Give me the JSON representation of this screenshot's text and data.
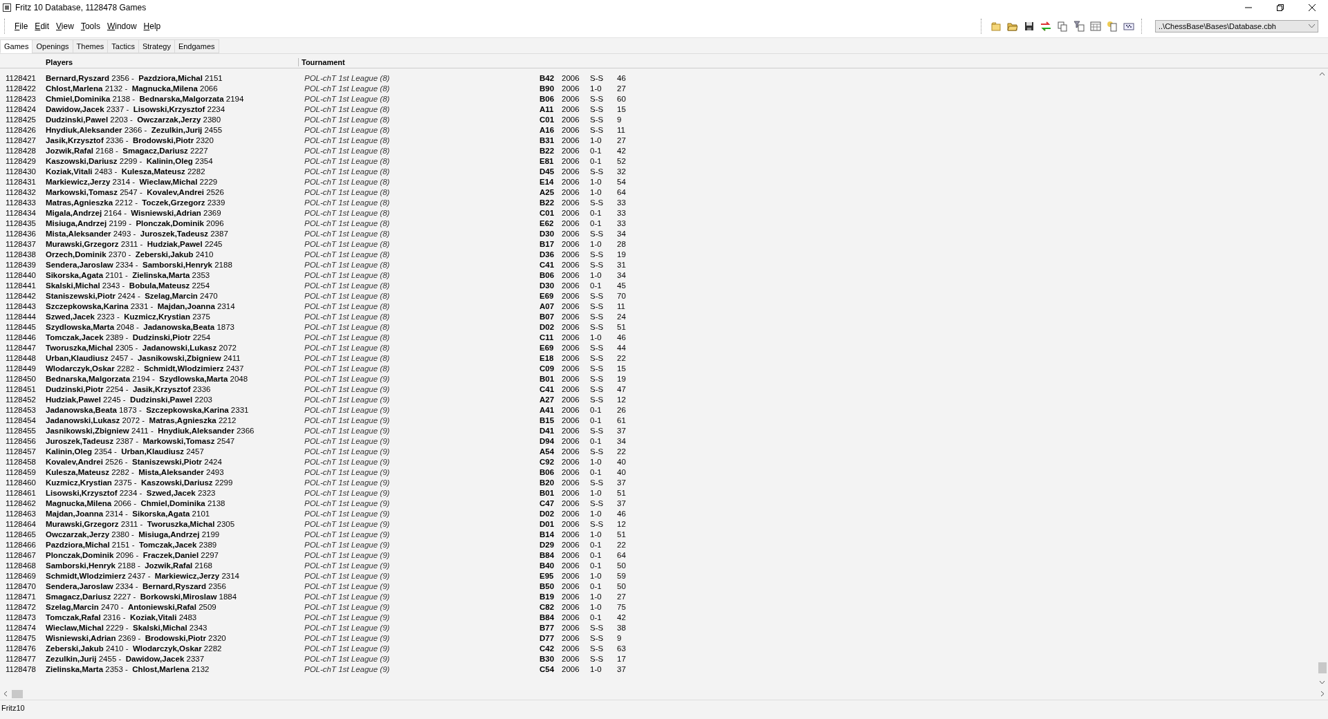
{
  "window": {
    "title": "Fritz 10 Database,  1128478 Games"
  },
  "menu": [
    "File",
    "Edit",
    "View",
    "Tools",
    "Window",
    "Help"
  ],
  "database_selector": {
    "value": "..\\ChessBase\\Bases\\Database.cbh"
  },
  "tabs": [
    {
      "label": "Games",
      "selected": true
    },
    {
      "label": "Openings",
      "selected": false
    },
    {
      "label": "Themes",
      "selected": false
    },
    {
      "label": "Tactics",
      "selected": false
    },
    {
      "label": "Strategy",
      "selected": false
    },
    {
      "label": "Endgames",
      "selected": false
    }
  ],
  "table": {
    "columns": [
      "Players",
      "Tournament"
    ],
    "rows": [
      {
        "no": "1128421",
        "players": "**Bernard,Ryszard** 2356 -  **Pazdziora,Michal** 2151",
        "tournament": "POL-chT 1st League (8)",
        "eco": "B42",
        "year": "2006",
        "result": "S-S",
        "moves": "46"
      },
      {
        "no": "1128422",
        "players": "**Chlost,Marlena** 2132 -  **Magnucka,Milena** 2066",
        "tournament": "POL-chT 1st League (8)",
        "eco": "B90",
        "year": "2006",
        "result": "1-0",
        "moves": "27"
      },
      {
        "no": "1128423",
        "players": "**Chmiel,Dominika** 2138 -  **Bednarska,Malgorzata** 2194",
        "tournament": "POL-chT 1st League (8)",
        "eco": "B06",
        "year": "2006",
        "result": "S-S",
        "moves": "60"
      },
      {
        "no": "1128424",
        "players": "**Dawidow,Jacek** 2337 -  **Lisowski,Krzysztof** 2234",
        "tournament": "POL-chT 1st League (8)",
        "eco": "A11",
        "year": "2006",
        "result": "S-S",
        "moves": "15"
      },
      {
        "no": "1128425",
        "players": "**Dudzinski,Pawel** 2203 -  **Owczarzak,Jerzy** 2380",
        "tournament": "POL-chT 1st League (8)",
        "eco": "C01",
        "year": "2006",
        "result": "S-S",
        "moves": "9"
      },
      {
        "no": "1128426",
        "players": "**Hnydiuk,Aleksander** 2366 -  **Zezulkin,Jurij** 2455",
        "tournament": "POL-chT 1st League (8)",
        "eco": "A16",
        "year": "2006",
        "result": "S-S",
        "moves": "11"
      },
      {
        "no": "1128427",
        "players": "**Jasik,Krzysztof** 2336 -  **Brodowski,Piotr** 2320",
        "tournament": "POL-chT 1st League (8)",
        "eco": "B31",
        "year": "2006",
        "result": "1-0",
        "moves": "27"
      },
      {
        "no": "1128428",
        "players": "**Jozwik,Rafal** 2168 -  **Smagacz,Dariusz** 2227",
        "tournament": "POL-chT 1st League (8)",
        "eco": "B22",
        "year": "2006",
        "result": "0-1",
        "moves": "42"
      },
      {
        "no": "1128429",
        "players": "**Kaszowski,Dariusz** 2299 -  **Kalinin,Oleg** 2354",
        "tournament": "POL-chT 1st League (8)",
        "eco": "E81",
        "year": "2006",
        "result": "0-1",
        "moves": "52"
      },
      {
        "no": "1128430",
        "players": "**Koziak,Vitali** 2483 -  **Kulesza,Mateusz** 2282",
        "tournament": "POL-chT 1st League (8)",
        "eco": "D45",
        "year": "2006",
        "result": "S-S",
        "moves": "32"
      },
      {
        "no": "1128431",
        "players": "**Markiewicz,Jerzy** 2314 -  **Wieclaw,Michal** 2229",
        "tournament": "POL-chT 1st League (8)",
        "eco": "E14",
        "year": "2006",
        "result": "1-0",
        "moves": "54"
      },
      {
        "no": "1128432",
        "players": "**Markowski,Tomasz** 2547 -  **Kovalev,Andrei** 2526",
        "tournament": "POL-chT 1st League (8)",
        "eco": "A25",
        "year": "2006",
        "result": "1-0",
        "moves": "64"
      },
      {
        "no": "1128433",
        "players": "**Matras,Agnieszka** 2212 -  **Toczek,Grzegorz** 2339",
        "tournament": "POL-chT 1st League (8)",
        "eco": "B22",
        "year": "2006",
        "result": "S-S",
        "moves": "33"
      },
      {
        "no": "1128434",
        "players": "**Migala,Andrzej** 2164 -  **Wisniewski,Adrian** 2369",
        "tournament": "POL-chT 1st League (8)",
        "eco": "C01",
        "year": "2006",
        "result": "0-1",
        "moves": "33"
      },
      {
        "no": "1128435",
        "players": "**Misiuga,Andrzej** 2199 -  **Plonczak,Dominik** 2096",
        "tournament": "POL-chT 1st League (8)",
        "eco": "E62",
        "year": "2006",
        "result": "0-1",
        "moves": "33"
      },
      {
        "no": "1128436",
        "players": "**Mista,Aleksander** 2493 -  **Juroszek,Tadeusz** 2387",
        "tournament": "POL-chT 1st League (8)",
        "eco": "D30",
        "year": "2006",
        "result": "S-S",
        "moves": "34"
      },
      {
        "no": "1128437",
        "players": "**Murawski,Grzegorz** 2311 -  **Hudziak,Pawel** 2245",
        "tournament": "POL-chT 1st League (8)",
        "eco": "B17",
        "year": "2006",
        "result": "1-0",
        "moves": "28"
      },
      {
        "no": "1128438",
        "players": "**Orzech,Dominik** 2370 -  **Zeberski,Jakub** 2410",
        "tournament": "POL-chT 1st League (8)",
        "eco": "D36",
        "year": "2006",
        "result": "S-S",
        "moves": "19"
      },
      {
        "no": "1128439",
        "players": "**Sendera,Jaroslaw** 2334 -  **Samborski,Henryk** 2188",
        "tournament": "POL-chT 1st League (8)",
        "eco": "C41",
        "year": "2006",
        "result": "S-S",
        "moves": "31"
      },
      {
        "no": "1128440",
        "players": "**Sikorska,Agata** 2101 -  **Zielinska,Marta** 2353",
        "tournament": "POL-chT 1st League (8)",
        "eco": "B06",
        "year": "2006",
        "result": "1-0",
        "moves": "34"
      },
      {
        "no": "1128441",
        "players": "**Skalski,Michal** 2343 -  **Bobula,Mateusz** 2254",
        "tournament": "POL-chT 1st League (8)",
        "eco": "D30",
        "year": "2006",
        "result": "0-1",
        "moves": "45"
      },
      {
        "no": "1128442",
        "players": "**Staniszewski,Piotr** 2424 -  **Szelag,Marcin** 2470",
        "tournament": "POL-chT 1st League (8)",
        "eco": "E69",
        "year": "2006",
        "result": "S-S",
        "moves": "70"
      },
      {
        "no": "1128443",
        "players": "**Szczepkowska,Karina** 2331 -  **Majdan,Joanna** 2314",
        "tournament": "POL-chT 1st League (8)",
        "eco": "A07",
        "year": "2006",
        "result": "S-S",
        "moves": "11"
      },
      {
        "no": "1128444",
        "players": "**Szwed,Jacek** 2323 -  **Kuzmicz,Krystian** 2375",
        "tournament": "POL-chT 1st League (8)",
        "eco": "B07",
        "year": "2006",
        "result": "S-S",
        "moves": "24"
      },
      {
        "no": "1128445",
        "players": "**Szydlowska,Marta** 2048 -  **Jadanowska,Beata** 1873",
        "tournament": "POL-chT 1st League (8)",
        "eco": "D02",
        "year": "2006",
        "result": "S-S",
        "moves": "51"
      },
      {
        "no": "1128446",
        "players": "**Tomczak,Jacek** 2389 -  **Dudzinski,Piotr** 2254",
        "tournament": "POL-chT 1st League (8)",
        "eco": "C11",
        "year": "2006",
        "result": "1-0",
        "moves": "46"
      },
      {
        "no": "1128447",
        "players": "**Tworuszka,Michal** 2305 -  **Jadanowski,Lukasz** 2072",
        "tournament": "POL-chT 1st League (8)",
        "eco": "E69",
        "year": "2006",
        "result": "S-S",
        "moves": "44"
      },
      {
        "no": "1128448",
        "players": "**Urban,Klaudiusz** 2457 -  **Jasnikowski,Zbigniew** 2411",
        "tournament": "POL-chT 1st League (8)",
        "eco": "E18",
        "year": "2006",
        "result": "S-S",
        "moves": "22"
      },
      {
        "no": "1128449",
        "players": "**Wlodarczyk,Oskar** 2282 -  **Schmidt,Wlodzimierz** 2437",
        "tournament": "POL-chT 1st League (8)",
        "eco": "C09",
        "year": "2006",
        "result": "S-S",
        "moves": "15"
      },
      {
        "no": "1128450",
        "players": "**Bednarska,Malgorzata** 2194 -  **Szydlowska,Marta** 2048",
        "tournament": "POL-chT 1st League (9)",
        "eco": "B01",
        "year": "2006",
        "result": "S-S",
        "moves": "19"
      },
      {
        "no": "1128451",
        "players": "**Dudzinski,Piotr** 2254 -  **Jasik,Krzysztof** 2336",
        "tournament": "POL-chT 1st League (9)",
        "eco": "C41",
        "year": "2006",
        "result": "S-S",
        "moves": "47"
      },
      {
        "no": "1128452",
        "players": "**Hudziak,Pawel** 2245 -  **Dudzinski,Pawel** 2203",
        "tournament": "POL-chT 1st League (9)",
        "eco": "A27",
        "year": "2006",
        "result": "S-S",
        "moves": "12"
      },
      {
        "no": "1128453",
        "players": "**Jadanowska,Beata** 1873 -  **Szczepkowska,Karina** 2331",
        "tournament": "POL-chT 1st League (9)",
        "eco": "A41",
        "year": "2006",
        "result": "0-1",
        "moves": "26"
      },
      {
        "no": "1128454",
        "players": "**Jadanowski,Lukasz** 2072 -  **Matras,Agnieszka** 2212",
        "tournament": "POL-chT 1st League (9)",
        "eco": "B15",
        "year": "2006",
        "result": "0-1",
        "moves": "61"
      },
      {
        "no": "1128455",
        "players": "**Jasnikowski,Zbigniew** 2411 -  **Hnydiuk,Aleksander** 2366",
        "tournament": "POL-chT 1st League (9)",
        "eco": "D41",
        "year": "2006",
        "result": "S-S",
        "moves": "37"
      },
      {
        "no": "1128456",
        "players": "**Juroszek,Tadeusz** 2387 -  **Markowski,Tomasz** 2547",
        "tournament": "POL-chT 1st League (9)",
        "eco": "D94",
        "year": "2006",
        "result": "0-1",
        "moves": "34"
      },
      {
        "no": "1128457",
        "players": "**Kalinin,Oleg** 2354 -  **Urban,Klaudiusz** 2457",
        "tournament": "POL-chT 1st League (9)",
        "eco": "A54",
        "year": "2006",
        "result": "S-S",
        "moves": "22"
      },
      {
        "no": "1128458",
        "players": "**Kovalev,Andrei** 2526 -  **Staniszewski,Piotr** 2424",
        "tournament": "POL-chT 1st League (9)",
        "eco": "C92",
        "year": "2006",
        "result": "1-0",
        "moves": "40"
      },
      {
        "no": "1128459",
        "players": "**Kulesza,Mateusz** 2282 -  **Mista,Aleksander** 2493",
        "tournament": "POL-chT 1st League (9)",
        "eco": "B06",
        "year": "2006",
        "result": "0-1",
        "moves": "40"
      },
      {
        "no": "1128460",
        "players": "**Kuzmicz,Krystian** 2375 -  **Kaszowski,Dariusz** 2299",
        "tournament": "POL-chT 1st League (9)",
        "eco": "B20",
        "year": "2006",
        "result": "S-S",
        "moves": "37"
      },
      {
        "no": "1128461",
        "players": "**Lisowski,Krzysztof** 2234 -  **Szwed,Jacek** 2323",
        "tournament": "POL-chT 1st League (9)",
        "eco": "B01",
        "year": "2006",
        "result": "1-0",
        "moves": "51"
      },
      {
        "no": "1128462",
        "players": "**Magnucka,Milena** 2066 -  **Chmiel,Dominika** 2138",
        "tournament": "POL-chT 1st League (9)",
        "eco": "C47",
        "year": "2006",
        "result": "S-S",
        "moves": "37"
      },
      {
        "no": "1128463",
        "players": "**Majdan,Joanna** 2314 -  **Sikorska,Agata** 2101",
        "tournament": "POL-chT 1st League (9)",
        "eco": "D02",
        "year": "2006",
        "result": "1-0",
        "moves": "46"
      },
      {
        "no": "1128464",
        "players": "**Murawski,Grzegorz** 2311 -  **Tworuszka,Michal** 2305",
        "tournament": "POL-chT 1st League (9)",
        "eco": "D01",
        "year": "2006",
        "result": "S-S",
        "moves": "12"
      },
      {
        "no": "1128465",
        "players": "**Owczarzak,Jerzy** 2380 -  **Misiuga,Andrzej** 2199",
        "tournament": "POL-chT 1st League (9)",
        "eco": "B14",
        "year": "2006",
        "result": "1-0",
        "moves": "51"
      },
      {
        "no": "1128466",
        "players": "**Pazdziora,Michal** 2151 -  **Tomczak,Jacek** 2389",
        "tournament": "POL-chT 1st League (9)",
        "eco": "D29",
        "year": "2006",
        "result": "0-1",
        "moves": "22"
      },
      {
        "no": "1128467",
        "players": "**Plonczak,Dominik** 2096 -  **Fraczek,Daniel** 2297",
        "tournament": "POL-chT 1st League (9)",
        "eco": "B84",
        "year": "2006",
        "result": "0-1",
        "moves": "64"
      },
      {
        "no": "1128468",
        "players": "**Samborski,Henryk** 2188 -  **Jozwik,Rafal** 2168",
        "tournament": "POL-chT 1st League (9)",
        "eco": "B40",
        "year": "2006",
        "result": "0-1",
        "moves": "50"
      },
      {
        "no": "1128469",
        "players": "**Schmidt,Wlodzimierz** 2437 -  **Markiewicz,Jerzy** 2314",
        "tournament": "POL-chT 1st League (9)",
        "eco": "E95",
        "year": "2006",
        "result": "1-0",
        "moves": "59"
      },
      {
        "no": "1128470",
        "players": "**Sendera,Jaroslaw** 2334 -  **Bernard,Ryszard** 2356",
        "tournament": "POL-chT 1st League (9)",
        "eco": "B50",
        "year": "2006",
        "result": "0-1",
        "moves": "50"
      },
      {
        "no": "1128471",
        "players": "**Smagacz,Dariusz** 2227 -  **Borkowski,Miroslaw** 1884",
        "tournament": "POL-chT 1st League (9)",
        "eco": "B19",
        "year": "2006",
        "result": "1-0",
        "moves": "27"
      },
      {
        "no": "1128472",
        "players": "**Szelag,Marcin** 2470 -  **Antoniewski,Rafal** 2509",
        "tournament": "POL-chT 1st League (9)",
        "eco": "C82",
        "year": "2006",
        "result": "1-0",
        "moves": "75"
      },
      {
        "no": "1128473",
        "players": "**Tomczak,Rafal** 2316 -  **Koziak,Vitali** 2483",
        "tournament": "POL-chT 1st League (9)",
        "eco": "B84",
        "year": "2006",
        "result": "0-1",
        "moves": "42"
      },
      {
        "no": "1128474",
        "players": "**Wieclaw,Michal** 2229 -  **Skalski,Michal** 2343",
        "tournament": "POL-chT 1st League (9)",
        "eco": "B77",
        "year": "2006",
        "result": "S-S",
        "moves": "38"
      },
      {
        "no": "1128475",
        "players": "**Wisniewski,Adrian** 2369 -  **Brodowski,Piotr** 2320",
        "tournament": "POL-chT 1st League (9)",
        "eco": "D77",
        "year": "2006",
        "result": "S-S",
        "moves": "9"
      },
      {
        "no": "1128476",
        "players": "**Zeberski,Jakub** 2410 -  **Wlodarczyk,Oskar** 2282",
        "tournament": "POL-chT 1st League (9)",
        "eco": "C42",
        "year": "2006",
        "result": "S-S",
        "moves": "63"
      },
      {
        "no": "1128477",
        "players": "**Zezulkin,Jurij** 2455 -  **Dawidow,Jacek** 2337",
        "tournament": "POL-chT 1st League (9)",
        "eco": "B30",
        "year": "2006",
        "result": "S-S",
        "moves": "17"
      },
      {
        "no": "1128478",
        "players": "**Zielinska,Marta** 2353 -  **Chlost,Marlena** 2132",
        "tournament": "POL-chT 1st League (9)",
        "eco": "C54",
        "year": "2006",
        "result": "1-0",
        "moves": "37"
      }
    ]
  },
  "status_bar": "Fritz10"
}
